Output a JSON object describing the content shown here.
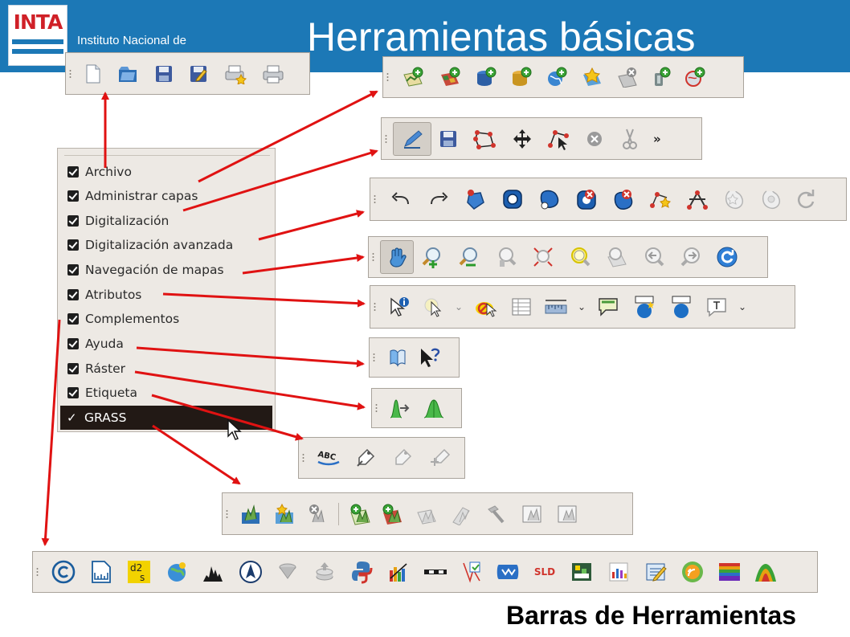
{
  "header": {
    "logo_text": "INTA",
    "institute_text": "Instituto Nacional de",
    "title": "Herramientas básicas"
  },
  "menu": {
    "items": [
      {
        "label": "Archivo",
        "checked": true
      },
      {
        "label": "Administrar capas",
        "checked": true
      },
      {
        "label": "Digitalización",
        "checked": true
      },
      {
        "label": "Digitalización avanzada",
        "checked": true
      },
      {
        "label": "Navegación de mapas",
        "checked": true
      },
      {
        "label": "Atributos",
        "checked": true
      },
      {
        "label": "Complementos",
        "checked": true
      },
      {
        "label": "Ayuda",
        "checked": true
      },
      {
        "label": "Ráster",
        "checked": true
      },
      {
        "label": "Etiqueta",
        "checked": true
      },
      {
        "label": "GRASS",
        "checked": true,
        "selected": true
      }
    ],
    "selected_tick": "✓"
  },
  "toolbars": {
    "archivo": [
      "new-file-icon",
      "open-project-icon",
      "save-icon",
      "save-as-icon",
      "print-composer-new-icon",
      "print-composer-manager-icon"
    ],
    "administrar_capas": [
      "add-vector-layer-icon",
      "add-raster-layer-icon",
      "add-postgis-layer-icon",
      "add-spatialite-layer-icon",
      "add-wms-layer-icon",
      "add-wfs-layer-icon",
      "remove-layer-icon",
      "add-mssql-layer-icon",
      "add-wcs-layer-icon"
    ],
    "digitalizacion": [
      "toggle-editing-icon",
      "save-edits-icon",
      "add-feature-icon",
      "move-feature-icon",
      "node-tool-icon",
      "delete-selected-icon",
      "cut-features-icon"
    ],
    "digitalizacion_more": "»",
    "digitalizacion_avanzada": [
      "undo-icon",
      "redo-icon",
      "simplify-feature-icon",
      "add-ring-icon",
      "add-part-icon",
      "delete-ring-icon",
      "delete-part-icon",
      "reshape-features-icon",
      "split-features-icon",
      "offset-curve-icon",
      "rotate-point-symbols-icon",
      "rotate-feature-icon"
    ],
    "navegacion": [
      "pan-icon",
      "zoom-in-icon",
      "zoom-out-icon",
      "zoom-native-icon",
      "zoom-full-icon",
      "zoom-to-selection-icon",
      "zoom-to-layer-icon",
      "zoom-last-icon",
      "zoom-next-icon",
      "refresh-icon"
    ],
    "atributos": [
      "identify-icon",
      "select-features-icon",
      "deselect-icon",
      "attribute-table-icon",
      "measure-icon",
      "map-tips-icon",
      "new-bookmark-icon",
      "show-bookmarks-icon",
      "text-annotation-icon"
    ],
    "ayuda": [
      "help-contents-icon",
      "whats-this-icon"
    ],
    "raster": [
      "local-histogram-stretch-icon",
      "full-histogram-stretch-icon"
    ],
    "etiqueta": [
      "labeling-icon",
      "pin-labels-icon",
      "show-hide-labels-icon",
      "move-label-icon"
    ],
    "grass": [
      "open-grass-mapset-icon",
      "new-grass-mapset-icon",
      "close-grass-mapset-icon",
      "add-grass-vector-icon",
      "add-grass-raster-icon",
      "open-grass-tools-icon",
      "display-current-region-icon",
      "edit-current-region-icon",
      "edit-grass-vector-icon",
      "create-new-grass-vector-icon"
    ],
    "complementos": [
      "copyright-label-icon",
      "scale-bar-icon",
      "d2s-icon",
      "georeferencer-icon",
      "histogram-icon",
      "north-arrow-icon",
      "spatialite-icon",
      "db-manager-icon",
      "python-console-icon",
      "interpolation-icon",
      "scale-icon",
      "vector-topology-icon",
      "raster-terrain-icon",
      "sld-icon",
      "dem-icon",
      "heatmap-icon",
      "metadata-icon",
      "rss-icon",
      "color-ramp-icon",
      "terrain-profile-icon"
    ],
    "sld_label": "SLD",
    "d2s_label_top": "d2",
    "d2s_label_sub": "s"
  },
  "footer": {
    "caption": "Barras de Herramientas"
  },
  "colors": {
    "header_blue": "#1c78b6",
    "logo_red": "#d02027",
    "arrow_red": "#e01212",
    "toolbar_bg": "#ede9e4",
    "menu_selected_bg": "#221915"
  }
}
